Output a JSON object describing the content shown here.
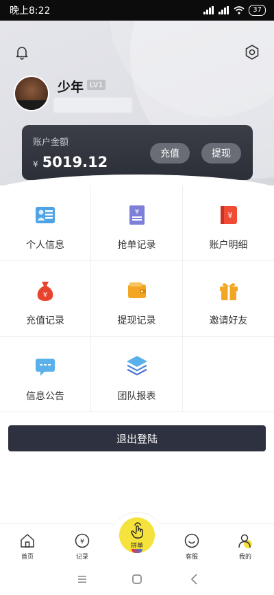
{
  "status_bar": {
    "time": "晚上8:22",
    "battery": "37"
  },
  "profile": {
    "username": "少年",
    "level": "LV1"
  },
  "balance": {
    "label": "账户金额",
    "currency": "¥",
    "amount": "5019.12",
    "recharge_label": "充值",
    "withdraw_label": "提现"
  },
  "menu": [
    {
      "label": "个人信息",
      "icon": "id-card-icon"
    },
    {
      "label": "抢单记录",
      "icon": "order-record-icon"
    },
    {
      "label": "账户明细",
      "icon": "account-detail-icon"
    },
    {
      "label": "充值记录",
      "icon": "money-bag-icon"
    },
    {
      "label": "提现记录",
      "icon": "wallet-icon"
    },
    {
      "label": "邀请好友",
      "icon": "gift-icon"
    },
    {
      "label": "信息公告",
      "icon": "message-icon"
    },
    {
      "label": "团队报表",
      "icon": "layers-icon"
    }
  ],
  "logout_label": "退出登陆",
  "tabs": [
    {
      "label": "首页",
      "icon": "home-icon"
    },
    {
      "label": "记录",
      "icon": "record-icon"
    },
    {
      "label": "拼单",
      "icon": "hand-tap-icon"
    },
    {
      "label": "客服",
      "icon": "smile-icon"
    },
    {
      "label": "我的",
      "icon": "user-icon"
    }
  ],
  "colors": {
    "accent": "#f6e23c",
    "dark": "#2e3240",
    "blue": "#5aa7e8",
    "red": "#e8432f",
    "orange": "#f3a623"
  }
}
